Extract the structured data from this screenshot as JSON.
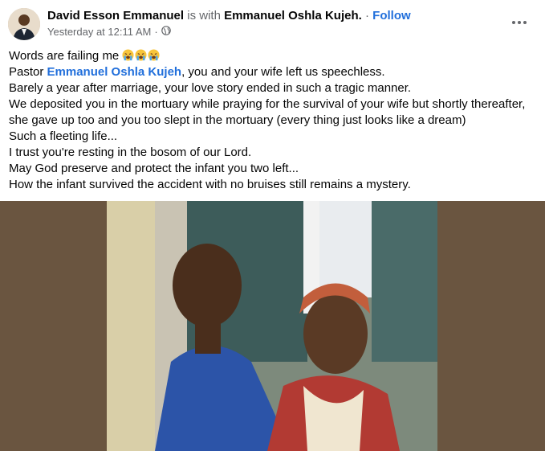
{
  "post": {
    "author": "David Esson Emmanuel",
    "with_text": "is with",
    "tagged": "Emmanuel Oshla Kujeh.",
    "separator": "·",
    "follow_label": "Follow",
    "timestamp": "Yesterday at 12:11 AM",
    "meta_separator": "·",
    "privacy_icon": "globe-icon",
    "more_icon": "more-horizontal-icon"
  },
  "body": {
    "line1": "Words are failing me",
    "line1_emojis": [
      "crying-face-emoji",
      "crying-face-emoji",
      "crying-face-emoji"
    ],
    "line2_prefix": "Pastor",
    "line2_mention": "Emmanuel Oshla Kujeh",
    "line2_suffix": ", you and your wife left us speechless.",
    "line3": "Barely a year after marriage, your love story ended in such a tragic manner.",
    "line4": "We deposited you in the mortuary while praying for the survival of your wife but shortly thereafter,",
    "line5": "she gave up too and you too slept in the mortuary (every thing just looks like a dream)",
    "line6": "Such a fleeting life...",
    "line7": "I trust you're resting in the bosom of our Lord.",
    "line8": "May God preserve and protect the infant you two left...",
    "line9": "How the infant survived the accident with no bruises still remains a mystery."
  },
  "colors": {
    "link": "#216fdb",
    "meta": "#65676b",
    "photo_backdrop": "#6a5540"
  }
}
